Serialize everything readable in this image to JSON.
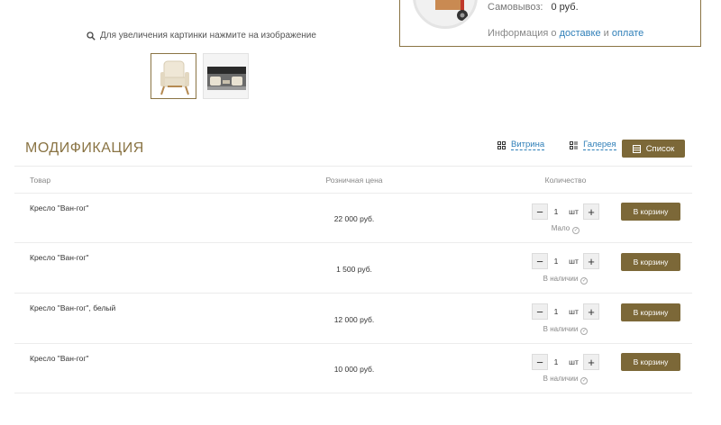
{
  "delivery": {
    "pickup_label": "Самовывоз:",
    "pickup_value": "0 руб.",
    "info_prefix": "Информация о",
    "info_delivery_link": "доставке",
    "info_and": "и",
    "info_payment_link": "оплате"
  },
  "gallery": {
    "zoom_hint": "Для увеличения картинки нажмите на изображение"
  },
  "section": {
    "title": "МОДИФИКАЦИЯ",
    "view_showcase": "Витрина",
    "view_gallery": "Галерея",
    "view_list": "Список"
  },
  "table": {
    "headers": {
      "product": "Товар",
      "price": "Розничная цена",
      "quantity": "Количество"
    },
    "rows": [
      {
        "name": "Кресло \"Ван-гог\"",
        "price": "22 000 руб.",
        "qty": "1",
        "unit": "шт",
        "stock": "Мало",
        "cart": "В корзину"
      },
      {
        "name": "Кресло \"Ван-гог\"",
        "price": "1 500 руб.",
        "qty": "1",
        "unit": "шт",
        "stock": "В наличии",
        "cart": "В корзину"
      },
      {
        "name": "Кресло \"Ван-гог\", белый",
        "price": "12 000 руб.",
        "qty": "1",
        "unit": "шт",
        "stock": "В наличии",
        "cart": "В корзину"
      },
      {
        "name": "Кресло \"Ван-гог\"",
        "price": "10 000 руб.",
        "qty": "1",
        "unit": "шт",
        "stock": "В наличии",
        "cart": "В корзину"
      }
    ]
  },
  "colors": {
    "accent": "#7c6838",
    "link": "#2f7fb8"
  }
}
